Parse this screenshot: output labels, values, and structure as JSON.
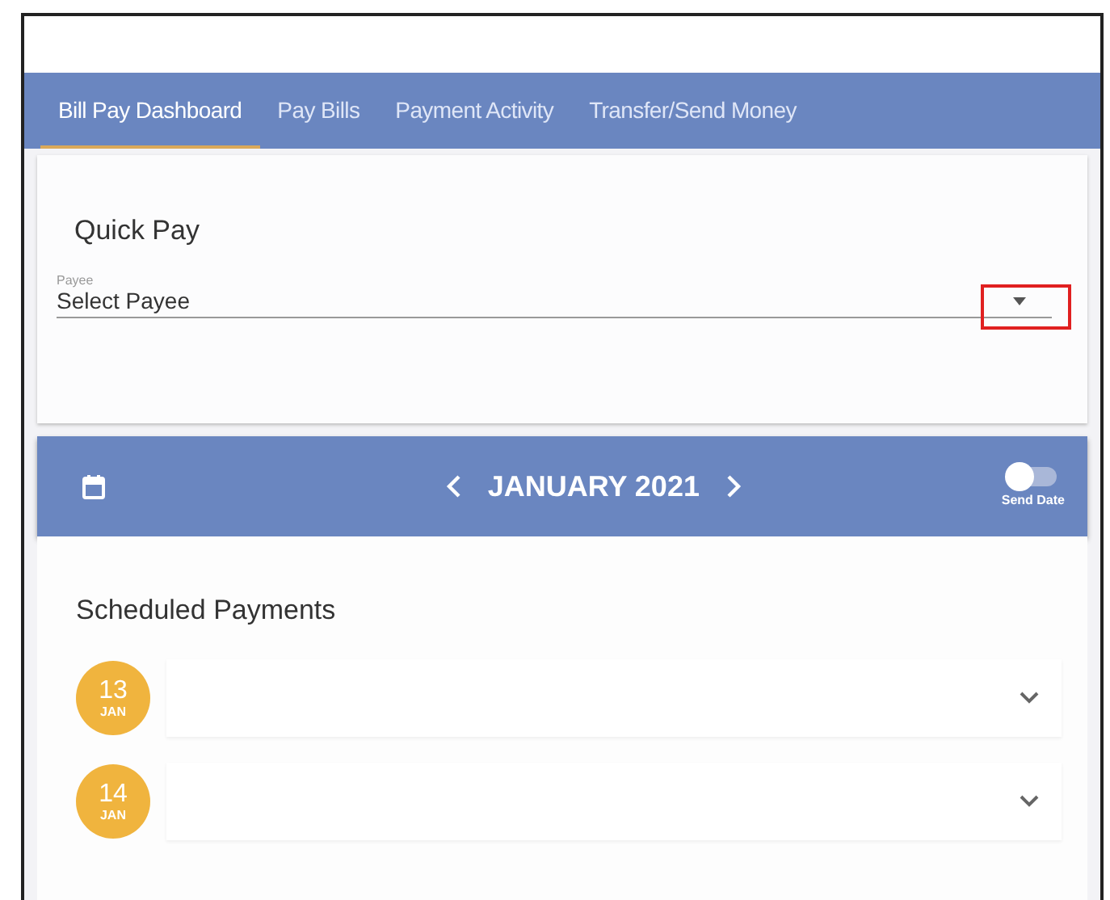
{
  "tabs": [
    {
      "label": "Bill Pay Dashboard",
      "selected": true
    },
    {
      "label": "Pay Bills",
      "selected": false
    },
    {
      "label": "Payment Activity",
      "selected": false
    },
    {
      "label": "Transfer/Send Money",
      "selected": false
    }
  ],
  "quick_pay": {
    "title": "Quick Pay",
    "payee_field": {
      "label": "Payee",
      "value": "Select Payee"
    }
  },
  "calendar_bar": {
    "month": "JANUARY 2021",
    "send_date_toggle": {
      "label": "Send Date",
      "on": false
    }
  },
  "scheduled_payments": {
    "title": "Scheduled Payments",
    "items": [
      {
        "day": "13",
        "month": "JAN",
        "expanded": false
      },
      {
        "day": "14",
        "month": "JAN",
        "expanded": false
      }
    ]
  }
}
